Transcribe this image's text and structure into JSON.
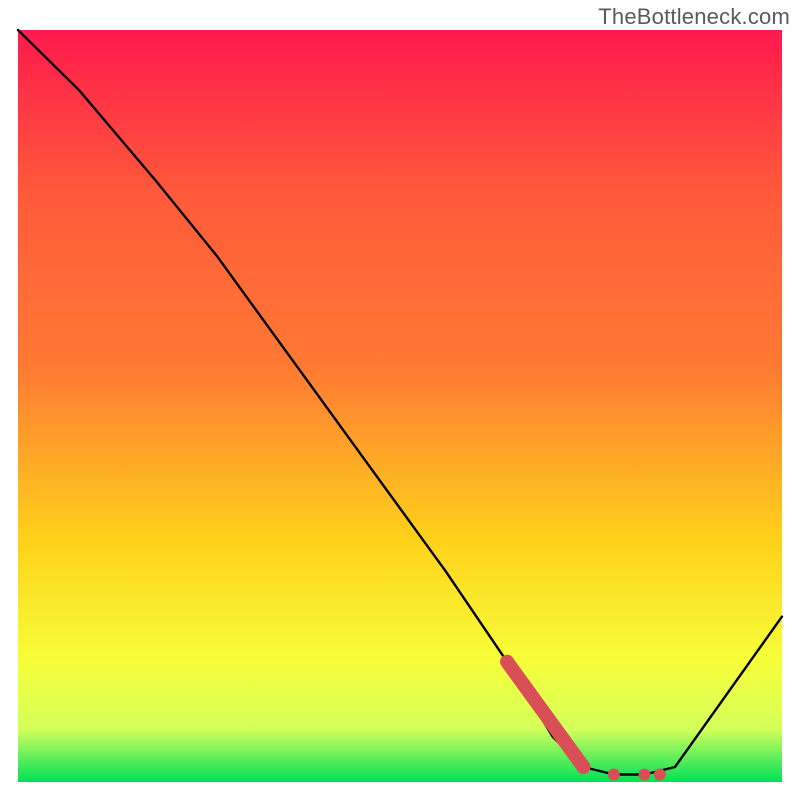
{
  "watermark": "TheBottleneck.com",
  "chart_data": {
    "type": "line",
    "title": "",
    "xlabel": "",
    "ylabel": "",
    "xlim": [
      0,
      100
    ],
    "ylim": [
      0,
      100
    ],
    "series": [
      {
        "name": "bottleneck-curve",
        "x": [
          0,
          8,
          18,
          26,
          36,
          46,
          56,
          64,
          70,
          74,
          78,
          82,
          86,
          100
        ],
        "y": [
          100,
          92,
          80,
          70,
          56,
          42,
          28,
          16,
          6,
          2,
          1,
          1,
          2,
          22
        ]
      }
    ],
    "highlight_segment": {
      "name": "highlight-band",
      "x": [
        64,
        74,
        78,
        82,
        84
      ],
      "y": [
        16,
        2,
        1,
        1,
        1
      ]
    },
    "gradient": {
      "top_color": "#ff1a4d",
      "upper_mid_color": "#ff7a33",
      "mid_color": "#ffd21a",
      "lower_mid_color": "#f6ff3a",
      "low_color": "#d3ff5a",
      "bottom_color": "#00e05a"
    }
  }
}
